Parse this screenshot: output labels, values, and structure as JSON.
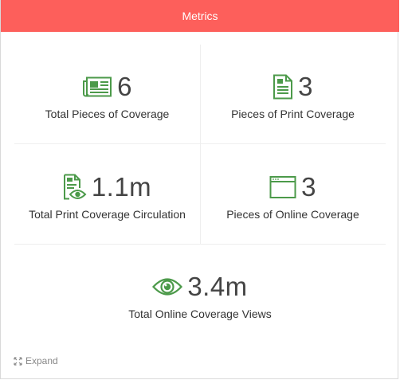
{
  "header": {
    "title": "Metrics"
  },
  "colors": {
    "header_background": "#fd5f5b",
    "icon_green": "#4c9a4a"
  },
  "metrics": [
    {
      "icon": "newspaper-icon",
      "value": "6",
      "label": "Total Pieces of Coverage"
    },
    {
      "icon": "document-icon",
      "value": "3",
      "label": "Pieces of Print Coverage"
    },
    {
      "icon": "document-eye-icon",
      "value": "1.1m",
      "label": "Total Print Coverage Circulation"
    },
    {
      "icon": "browser-window-icon",
      "value": "3",
      "label": "Pieces of Online Coverage"
    },
    {
      "icon": "eye-icon",
      "value": "3.4m",
      "label": "Total Online Coverage Views"
    }
  ],
  "footer": {
    "expand_label": "Expand"
  }
}
